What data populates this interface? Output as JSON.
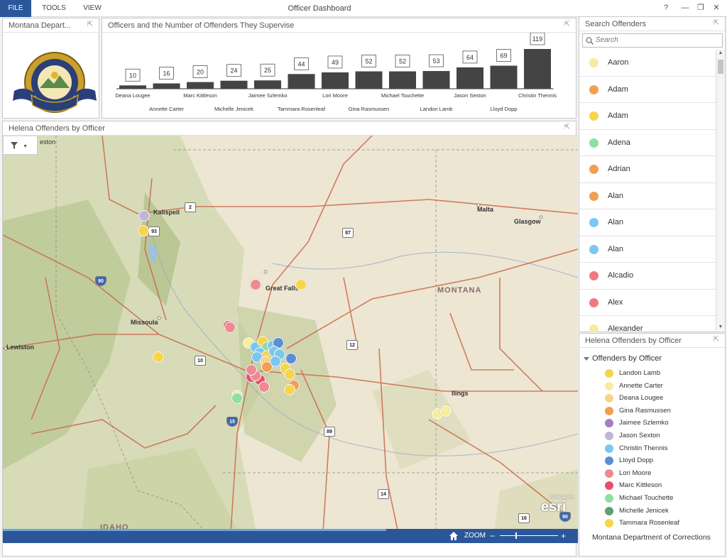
{
  "menu": {
    "file": "FILE",
    "tools": "TOOLS",
    "view": "VIEW"
  },
  "app_title": "Officer Dashboard",
  "window_controls": {
    "help": "?",
    "minimize": "—",
    "restore": "❐",
    "close": "✕"
  },
  "panels": {
    "logo_title": "Montana Depart...",
    "chart_title": "Officers and the Number of Offenders They Supervise",
    "map_title": "Helena Offenders by Officer",
    "search_title": "Search Offenders",
    "legend_title": "Helena Offenders by Officer"
  },
  "chart_data": {
    "type": "bar",
    "categories": [
      "Deana Lougee",
      "Annette Carter",
      "Marc Kittleson",
      "Michelle Jenicek",
      "Jaimee Szlemko",
      "Tammara Rosenleaf",
      "Lori Moore",
      "Gina Rasmussen",
      "Michael Touchette",
      "Landon Lamb",
      "Jason Sexton",
      "Lloyd Dopp",
      "Christin Thennis"
    ],
    "values": [
      10,
      16,
      20,
      24,
      25,
      44,
      49,
      52,
      52,
      53,
      64,
      69,
      119
    ],
    "title": "Officers and the Number of Offenders They Supervise",
    "ylim": [
      0,
      119
    ],
    "color": "#444444",
    "grid": false
  },
  "map": {
    "filter_icon": "filter-icon",
    "labels": {
      "great_falls": "Great Falls",
      "missoula": "Missoula",
      "kalispell": "Kalispell",
      "lewiston": "Lewiston",
      "malta": "Malta",
      "glasgow": "Glasgow",
      "montana": "MONTANA",
      "idaho": "IDAHO",
      "billings": "llings",
      "top_partial": "eston"
    },
    "shields": {
      "i90": "90",
      "i15": "15",
      "us93": "93",
      "us2": "2",
      "us87": "87",
      "us12": "12",
      "us10": "10",
      "us89": "89",
      "us14": "14",
      "us16": "16",
      "i90b": "90"
    },
    "esri": "esri",
    "esri_powered": "POWERED BY",
    "zoom_label": "ZOOM",
    "zoom_minus": "−",
    "zoom_plus": "+",
    "zoom_level_fraction": 0.28
  },
  "search": {
    "placeholder": "Search",
    "items": [
      {
        "name": "Aaron",
        "color": "#f7e9a0"
      },
      {
        "name": "Adam",
        "color": "#f0a050"
      },
      {
        "name": "Adam",
        "color": "#f7d54a"
      },
      {
        "name": "Adena",
        "color": "#8de0a0"
      },
      {
        "name": "Adrian",
        "color": "#f0a050"
      },
      {
        "name": "Alan",
        "color": "#f0a050"
      },
      {
        "name": "Alan",
        "color": "#79c8f0"
      },
      {
        "name": "Alan",
        "color": "#79c8f0"
      },
      {
        "name": "Alcadio",
        "color": "#f07a80"
      },
      {
        "name": "Alex",
        "color": "#f07a80"
      },
      {
        "name": "Alexander",
        "color": "#f7e9a0"
      }
    ],
    "scroll_up": "▲",
    "scroll_down": "▼"
  },
  "legend": {
    "heading": "Offenders by Officer",
    "items": [
      {
        "name": "Landon Lamb",
        "color": "#f7d54a"
      },
      {
        "name": "Annette Carter",
        "color": "#f7ee9c"
      },
      {
        "name": "Deana Lougee",
        "color": "#f7d38a"
      },
      {
        "name": "Gina Rasmussen",
        "color": "#f0a050"
      },
      {
        "name": "Jaimee Szlemko",
        "color": "#a77cc8"
      },
      {
        "name": "Jason Sexton",
        "color": "#bdb6d6"
      },
      {
        "name": "Christin Thennis",
        "color": "#79c8f0"
      },
      {
        "name": "Lloyd Dopp",
        "color": "#5a8ed6"
      },
      {
        "name": "Lori Moore",
        "color": "#f08a90"
      },
      {
        "name": "Marc Kittleson",
        "color": "#e8506a"
      },
      {
        "name": "Michael Touchette",
        "color": "#8de0a0"
      },
      {
        "name": "Michelle Jenicek",
        "color": "#5f9e74"
      },
      {
        "name": "Tammara Rosenleaf",
        "color": "#f7d54a"
      }
    ],
    "footer": "Montana Department of Corrections"
  }
}
